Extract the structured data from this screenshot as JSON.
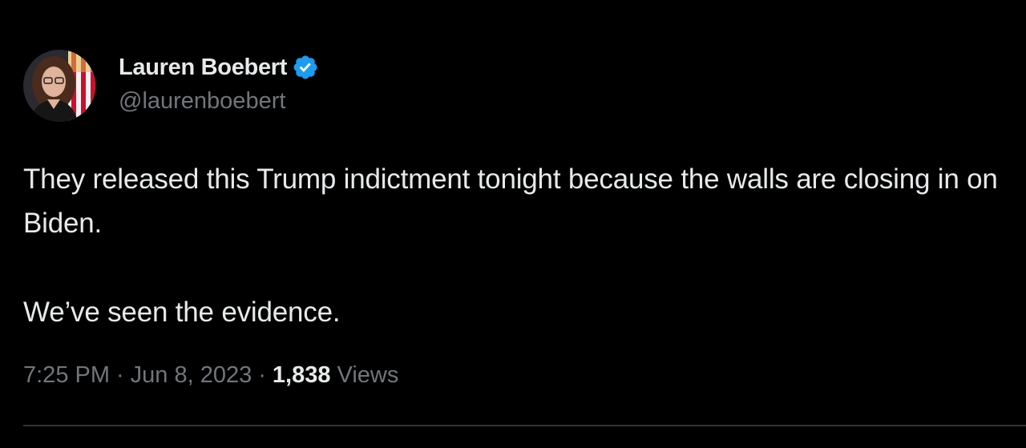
{
  "author": {
    "display_name": "Lauren Boebert",
    "handle": "@laurenboebert",
    "verified": true,
    "verified_icon": "verified-badge-icon",
    "verified_color": "#1d9bf0"
  },
  "tweet": {
    "paragraphs": [
      "They released this Trump indictment tonight because the walls are closing in on Biden.",
      "We’ve seen the evidence."
    ]
  },
  "meta": {
    "time": "7:25 PM",
    "separator": "·",
    "date": "Jun 8, 2023",
    "views_count": "1,838",
    "views_label": "Views"
  },
  "colors": {
    "background": "#000000",
    "text_primary": "#e7e9ea",
    "text_secondary": "#71767b",
    "divider": "#2f3336"
  }
}
